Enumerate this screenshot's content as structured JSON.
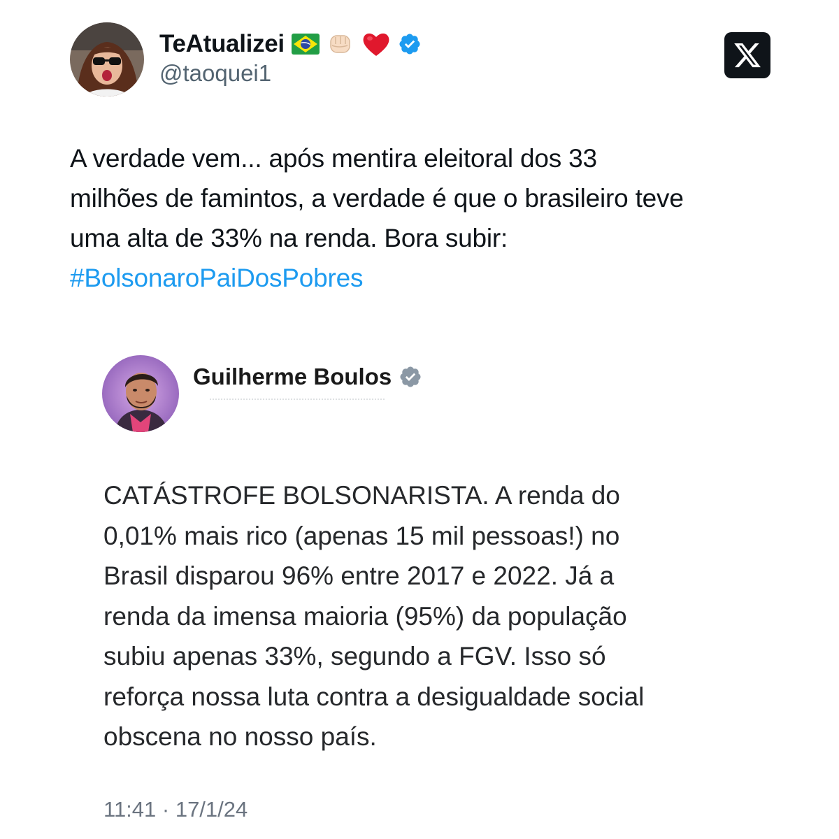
{
  "tweet": {
    "author": {
      "display_name": "TeAtualizei",
      "handle": "@taoquei1",
      "emojis": [
        "brazil-flag",
        "fist",
        "red-heart"
      ],
      "verified": true
    },
    "text_lines": [
      "A verdade vem... após  mentira eleitoral dos 33",
      "milhões de famintos, a verdade é que o brasileiro teve",
      "uma alta de 33% na renda. Bora subir:"
    ],
    "hashtag": "#BolsonaroPaiDosPobres",
    "platform_logo": "x-logo"
  },
  "quoted_tweet": {
    "author": {
      "display_name": "Guilherme Boulos",
      "verified": true
    },
    "text_lines": [
      "CATÁSTROFE BOLSONARISTA. A renda do",
      "0,01% mais rico (apenas 15 mil pessoas!) no",
      "Brasil disparou 96% entre 2017 e 2022. Já a",
      "renda da imensa maioria (95%) da população",
      "subiu apenas 33%, segundo a FGV. Isso só",
      "reforça nossa luta contra a desigualdade social",
      "obscena no nosso país."
    ],
    "timestamp": "11:41 · 17/1/24"
  },
  "colors": {
    "text": "#0f1419",
    "secondary": "#536471",
    "link": "#1d9bf0",
    "verified": "#1d9bf0",
    "quoted_verified": "#8b98a5"
  }
}
